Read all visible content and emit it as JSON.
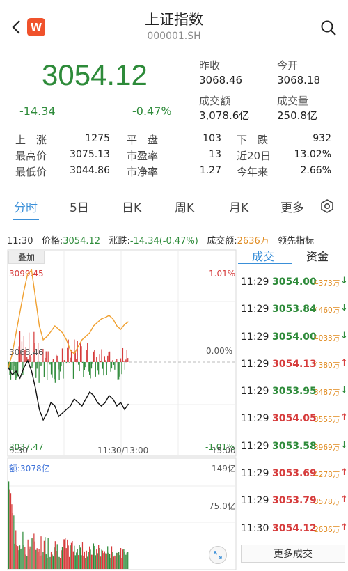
{
  "header": {
    "title": "上证指数",
    "code": "000001.SH",
    "logo_letter": "W"
  },
  "quote": {
    "price": "3054.12",
    "change": "-14.34",
    "change_pct": "-0.47%",
    "prev_close_label": "昨收",
    "prev_close": "3068.46",
    "open_label": "今开",
    "open": "3068.18",
    "turnover_label": "成交额",
    "turnover": "3,078.6亿",
    "volume_label": "成交量",
    "volume": "250.8亿"
  },
  "stats": {
    "up_label": "上　涨",
    "up": "1275",
    "flat_label": "平　盘",
    "flat": "103",
    "down_label": "下　跌",
    "down": "932",
    "high_label": "最高价",
    "high": "3075.13",
    "pe_label": "市盈率",
    "pe": "13",
    "d20_label": "近20日",
    "d20": "13.02%",
    "low_label": "最低价",
    "low": "3044.86",
    "pb_label": "市净率",
    "pb": "1.27",
    "ytd_label": "今年来",
    "ytd": "2.66%"
  },
  "tabs": [
    "分时",
    "5日",
    "日K",
    "周K",
    "月K",
    "更多"
  ],
  "info": {
    "time": "11:30",
    "price_label": "价格:",
    "price": "3054.12",
    "change_label": "涨跌:",
    "change": "-14.34(-0.47%)",
    "amount_label": "成交额:",
    "amount": "2636万",
    "leading_label": "领先指标"
  },
  "chart": {
    "overlay_label": "叠加",
    "y_top": "3099.45",
    "y_mid": "3068.46",
    "y_bot": "3037.47",
    "pct_top": "1.01%",
    "pct_mid": "0.00%",
    "pct_bot": "-1.01%",
    "time_start": "9:30",
    "time_mid": "11:30/13:00",
    "time_end": "15:00",
    "vol_label": "额:3078亿",
    "vol_top": "149亿",
    "vol_mid": "75.0亿",
    "colors": {
      "up": "#d63b3b",
      "down": "#2e8b3a",
      "avg": "#f0a030",
      "price": "#111111"
    }
  },
  "trade_tabs": {
    "deals": "成交",
    "funds": "资金"
  },
  "trades": [
    {
      "time": "11:29",
      "price": "3054.00",
      "vol": "4373万",
      "dir": "down"
    },
    {
      "time": "11:29",
      "price": "3053.84",
      "vol": "4460万",
      "dir": "down"
    },
    {
      "time": "11:29",
      "price": "3054.00",
      "vol": "4033万",
      "dir": "down"
    },
    {
      "time": "11:29",
      "price": "3054.13",
      "vol": "4380万",
      "dir": "up"
    },
    {
      "time": "11:29",
      "price": "3053.95",
      "vol": "3487万",
      "dir": "down"
    },
    {
      "time": "11:29",
      "price": "3054.05",
      "vol": "3555万",
      "dir": "up"
    },
    {
      "time": "11:29",
      "price": "3053.58",
      "vol": "3969万",
      "dir": "down"
    },
    {
      "time": "11:29",
      "price": "3053.69",
      "vol": "4278万",
      "dir": "up"
    },
    {
      "time": "11:29",
      "price": "3053.79",
      "vol": "3578万",
      "dir": "up"
    },
    {
      "time": "11:30",
      "price": "3054.12",
      "vol": "2636万",
      "dir": "up"
    }
  ],
  "more_trades_label": "更多成交"
}
